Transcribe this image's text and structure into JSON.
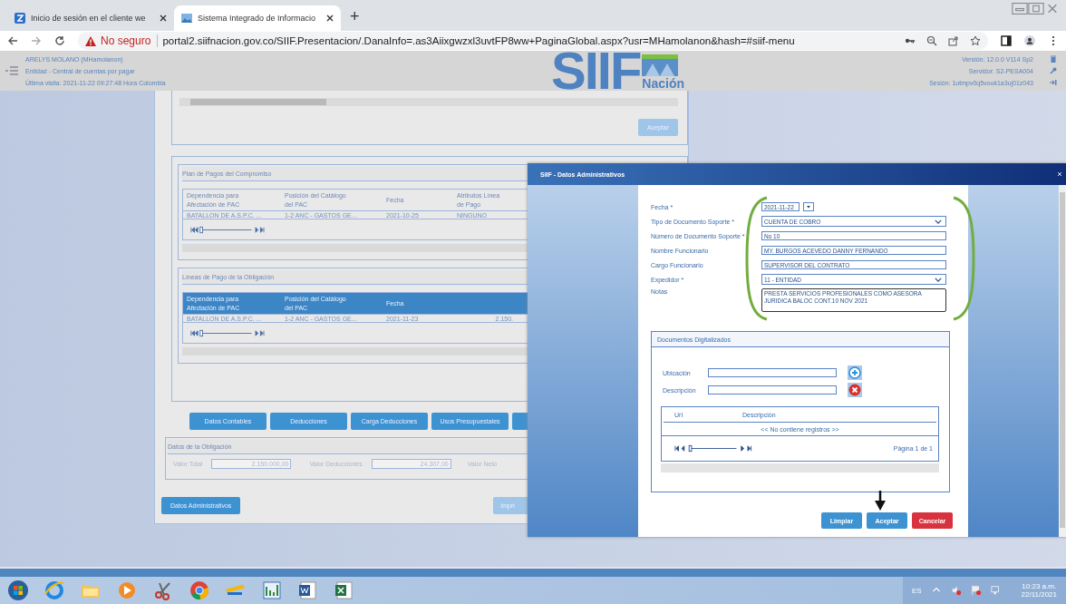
{
  "browser": {
    "tabs": [
      {
        "title": "Inicio de sesión en el cliente we",
        "selected": false
      },
      {
        "title": "Sistema Integrado de Informacio",
        "selected": true
      }
    ],
    "new_tab": "+",
    "url_warning": "No seguro",
    "url": "portal2.siifnacion.gov.co/SIIF.Presentacion/.DanaInfo=.as3Aiixgwzxl3uvtFP8ww+PaginaGlobal.aspx?usr=MHamolanon&hash=#siif-menu"
  },
  "app_header": {
    "user": "ARELYS MOLANO (MHamolanon)",
    "entity": "Entidad - Central de cuentas por pagar",
    "last_visit": "Última visita: 2021-11-22 09:27:48 Hora Colombia",
    "logo_text": "SIIF",
    "logo_sub": "Nación",
    "version": "Versión: 12.0.0 V114 Sp2",
    "server": "Servidor: S2-PESA004",
    "session": "Sesión: 1utmpv0q5vouk1a3uj01z043"
  },
  "background_page": {
    "top_button": "Aceptar",
    "tables": [
      {
        "title": "Plan de Pagos del Compromiso",
        "active": false,
        "columns": [
          "Dependencia para Afectación de PAC",
          "Posición del Catálogo del PAC",
          "Fecha",
          "Atributos Línea de Pago"
        ],
        "rows": [
          [
            "BATALLON DE A.S.P.C. ...",
            "1-2 ANC - GASTOS GE...",
            "2021-10-25",
            "NINGUNO"
          ]
        ]
      },
      {
        "title": "Líneas de Pago de la Obligación",
        "active": true,
        "columns": [
          "Dependencia para Afectación de PAC",
          "Posición del Catálogo del PAC",
          "Fecha"
        ],
        "rows": [
          [
            "BATALLON DE A.S.P.C. ...",
            "1-2 ANC - GASTOS GE...",
            "2021-11-23",
            "2.150."
          ]
        ]
      }
    ],
    "action_buttons": [
      "Datos Contables",
      "Deducciones",
      "Carga Deducciones",
      "Usos Presupuestales"
    ],
    "obligation": {
      "title": "Datos de la Obligación",
      "fields": [
        {
          "label": "Valor Total",
          "value": "2.150.000,00"
        },
        {
          "label": "Valor Deducciones",
          "value": "24.307,00"
        },
        {
          "label": "Valor Neto"
        }
      ]
    },
    "footer_buttons": [
      "Datos Administrativos",
      "Impri"
    ]
  },
  "dialog": {
    "title": "SIIF - Datos Administrativos",
    "fields": [
      {
        "label": "Fecha *",
        "kind": "date",
        "value": "2021-11-22",
        "focused": false
      },
      {
        "label": "Tipo de Documento Soporte *",
        "kind": "select",
        "value": "CUENTA DE COBRO",
        "focused": false
      },
      {
        "label": "Número de Documento Soporte *",
        "kind": "text",
        "value": "No 10",
        "focused": false
      },
      {
        "label": "Nombre Funcionario",
        "kind": "text",
        "value": "MY. BURGOS  ACEVEDO DANNY  FERNANDO",
        "focused": false
      },
      {
        "label": "Cargo Funcionario",
        "kind": "text",
        "value": "SUPERVISOR DEL CONTRATO",
        "focused": false
      },
      {
        "label": "Expedidor *",
        "kind": "select",
        "value": "11 - ENTIDAD",
        "focused": false
      },
      {
        "label": "Notas",
        "kind": "textarea",
        "value": "PRESTA SERVICIOS PROFESIONALES COMO ASESORA JURIDICA BALOC CONT.10 NOV 2021",
        "focused": true
      }
    ],
    "documents": {
      "title": "Documentos Digitalizados",
      "inputs": [
        {
          "label": "Ubicación",
          "kind": "add"
        },
        {
          "label": "Descripción",
          "kind": "remove"
        }
      ],
      "columns": [
        "Url",
        "Descripción"
      ],
      "empty": "<< No contiene registros >>",
      "page": "Página 1 de 1"
    },
    "buttons": [
      {
        "label": "Limpiar",
        "kind": "primary"
      },
      {
        "label": "Aceptar",
        "kind": "primary"
      },
      {
        "label": "Cancelar",
        "kind": "danger"
      }
    ]
  },
  "taskbar": {
    "language": "ES",
    "time": "10:23 a.m.",
    "date": "22/11/2021"
  }
}
